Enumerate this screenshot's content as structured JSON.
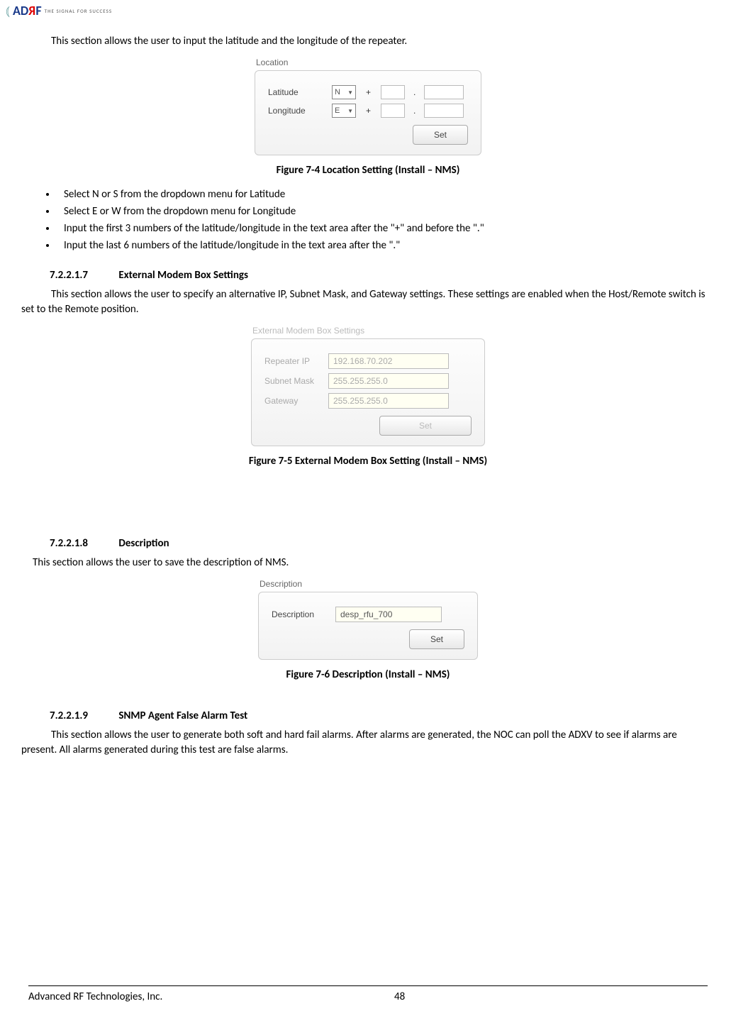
{
  "logo": {
    "tagline": "THE SIGNAL FOR SUCCESS"
  },
  "intro": "This section allows the user to input the latitude and the longitude of the repeater.",
  "location_panel": {
    "title": "Location",
    "row1_label": "Latitude",
    "row1_sel": "N",
    "row2_label": "Longitude",
    "row2_sel": "E",
    "plus": "+",
    "dot": ".",
    "set_btn": "Set"
  },
  "fig74": "Figure 7-4      Location Setting (Install – NMS)",
  "bullets": [
    "Select N or S from the dropdown menu for Latitude",
    "Select E or W from the dropdown menu for Longitude",
    "Input the first 3 numbers of the latitude/longitude in the text area after the \"+\" and before the \".\"",
    "Input the last 6 numbers of the latitude/longitude in the text area after the \".\""
  ],
  "sec7_heading_num": "7.2.2.1.7",
  "sec7_heading_title": "External Modem Box Settings",
  "sec7_para": "This section allows the user to specify an alternative IP, Subnet Mask, and Gateway settings.  These settings are enabled when the Host/Remote switch is set to the Remote position.",
  "modem_panel": {
    "title": "External Modem Box Settings",
    "row1_label": "Repeater IP",
    "row1_val": "192.168.70.202",
    "row2_label": "Subnet Mask",
    "row2_val": "255.255.255.0",
    "row3_label": "Gateway",
    "row3_val": "255.255.255.0",
    "set_btn": "Set"
  },
  "fig75": "Figure 7-5      External Modem Box Setting (Install – NMS)",
  "sec8_heading_num": "7.2.2.1.8",
  "sec8_heading_title": "Description",
  "sec8_para": "This section allows the user to save the description of NMS.",
  "desc_panel": {
    "title": "Description",
    "row1_label": "Description",
    "row1_val": "desp_rfu_700",
    "set_btn": "Set"
  },
  "fig76": "Figure 7-6      Description (Install – NMS)",
  "sec9_heading_num": "7.2.2.1.9",
  "sec9_heading_title": "SNMP Agent False Alarm Test",
  "sec9_para": "This section allows the user to generate both soft and hard fail alarms.  After alarms are generated, the NOC can poll the ADXV to see if alarms are present.  All alarms generated during this test are false alarms.",
  "footer": {
    "company": "Advanced RF Technologies, Inc.",
    "page": "48"
  }
}
